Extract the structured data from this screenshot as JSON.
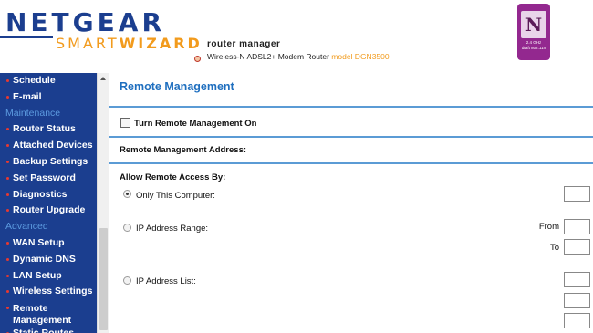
{
  "header": {
    "brand": "NETGEAR",
    "product_prefix": "SMART",
    "product_suffix": "WIZARD",
    "subtitle": "router manager",
    "description": "Wireless-N ADSL2+ Modem Router",
    "model": "model DGN3500",
    "badge": {
      "letter": "N",
      "line1": "2.4 GHz",
      "line2": "draft 802.11n"
    }
  },
  "sidebar": {
    "items": [
      {
        "type": "item",
        "label": "Schedule"
      },
      {
        "type": "item",
        "label": "E-mail"
      },
      {
        "type": "section",
        "label": "Maintenance"
      },
      {
        "type": "item",
        "label": "Router Status"
      },
      {
        "type": "item",
        "label": "Attached Devices"
      },
      {
        "type": "item",
        "label": "Backup Settings"
      },
      {
        "type": "item",
        "label": "Set Password"
      },
      {
        "type": "item",
        "label": "Diagnostics"
      },
      {
        "type": "item",
        "label": "Router Upgrade"
      },
      {
        "type": "section",
        "label": "Advanced"
      },
      {
        "type": "item",
        "label": "WAN Setup"
      },
      {
        "type": "item",
        "label": "Dynamic DNS"
      },
      {
        "type": "item",
        "label": "LAN Setup"
      },
      {
        "type": "item",
        "label": "Wireless Settings"
      },
      {
        "type": "item",
        "label": "Remote Management",
        "tall": true
      },
      {
        "type": "item",
        "label": "Static Routes"
      }
    ]
  },
  "main": {
    "title": "Remote Management",
    "turn_on_label": "Turn Remote Management On",
    "turn_on_checked": false,
    "address_label": "Remote Management Address:",
    "allow_label": "Allow Remote Access By:",
    "options": {
      "only_this": "Only This Computer:",
      "range": "IP Address Range:",
      "list": "IP Address List:"
    },
    "selected_option": "only_this",
    "from_label": "From",
    "to_label": "To"
  }
}
